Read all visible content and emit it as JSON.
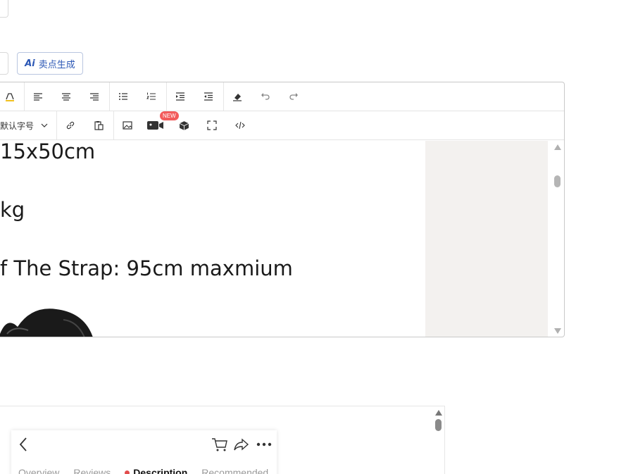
{
  "ai_button": {
    "label": "卖点生成",
    "icon": "ai-icon"
  },
  "editor": {
    "toolbar_row1": [
      {
        "name": "highlight-color-icon"
      },
      {
        "name": "align-left-icon"
      },
      {
        "name": "align-center-icon"
      },
      {
        "name": "align-right-icon"
      },
      {
        "name": "bullet-list-icon"
      },
      {
        "name": "numbered-list-icon"
      },
      {
        "name": "indent-increase-icon"
      },
      {
        "name": "indent-decrease-icon"
      },
      {
        "name": "clear-format-icon"
      },
      {
        "name": "undo-icon"
      },
      {
        "name": "redo-icon"
      }
    ],
    "toolbar_row2": {
      "font_size_label": "默认字号",
      "new_badge": "NEW"
    },
    "content_lines": [
      "15x50cm",
      "kg",
      "f The Strap: 95cm maxmium"
    ]
  },
  "preview": {
    "tabs": [
      "Overview",
      "Reviews",
      "Description",
      "Recommended"
    ],
    "active_tab": "Description"
  }
}
